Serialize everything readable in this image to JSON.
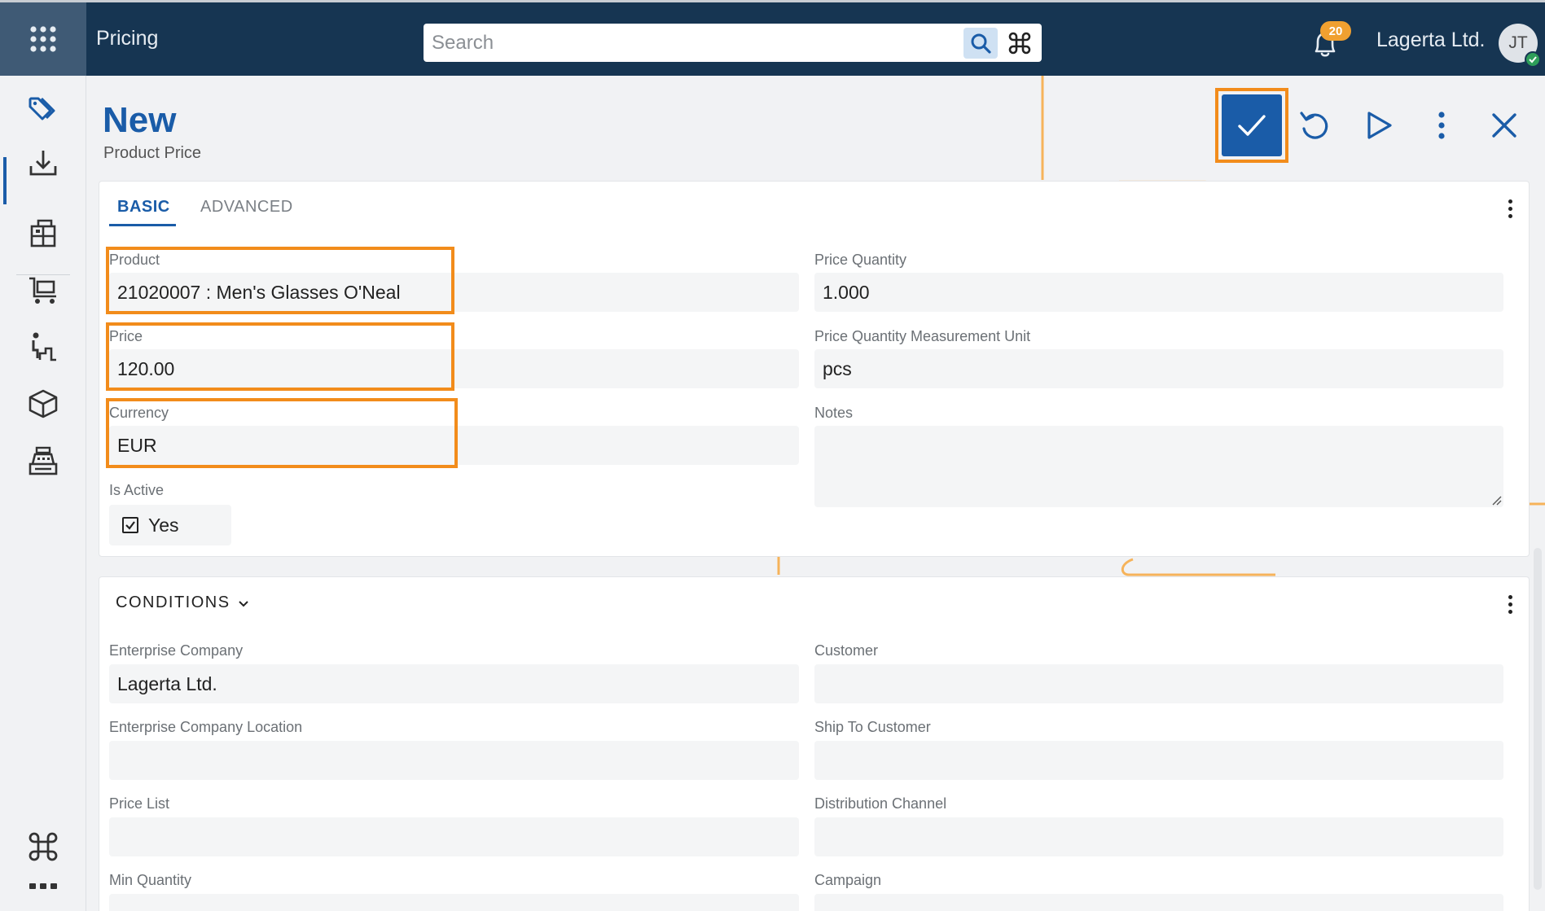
{
  "header": {
    "app_title": "Pricing",
    "search_placeholder": "Search",
    "notification_count": "20",
    "company": "Lagerta Ltd.",
    "user_initials": "JT"
  },
  "sidebar": {
    "items": [
      {
        "icon": "price-tag-icon",
        "active": true
      },
      {
        "icon": "download-tray-icon"
      },
      {
        "icon": "warehouse-boxes-icon"
      },
      {
        "icon": "shopping-cart-icon"
      },
      {
        "icon": "stairs-person-icon"
      },
      {
        "icon": "package-cube-icon"
      },
      {
        "icon": "cash-register-icon"
      },
      {
        "icon": "command-grid-icon"
      },
      {
        "icon": "more-dots-icon"
      }
    ]
  },
  "page": {
    "title": "New",
    "subtitle": "Product Price"
  },
  "toolbar": {
    "actions": [
      "save-check-icon",
      "undo-icon",
      "run-play-icon",
      "more-vertical-icon",
      "close-icon"
    ]
  },
  "basic_card": {
    "tabs": [
      {
        "label": "BASIC",
        "active": true
      },
      {
        "label": "ADVANCED",
        "active": false
      }
    ],
    "fields": {
      "product": {
        "label": "Product",
        "value": "21020007 : Men's Glasses O'Neal"
      },
      "price": {
        "label": "Price",
        "value": "120.00"
      },
      "currency": {
        "label": "Currency",
        "value": "EUR"
      },
      "is_active": {
        "label": "Is Active",
        "value": "Yes"
      },
      "price_quantity": {
        "label": "Price Quantity",
        "value": "1.000"
      },
      "price_quantity_unit": {
        "label": "Price Quantity Measurement Unit",
        "value": "pcs"
      },
      "notes": {
        "label": "Notes",
        "value": ""
      }
    }
  },
  "conditions_card": {
    "title": "CONDITIONS",
    "fields": {
      "enterprise_company": {
        "label": "Enterprise Company",
        "value": "Lagerta Ltd."
      },
      "customer": {
        "label": "Customer",
        "value": ""
      },
      "enterprise_company_location": {
        "label": "Enterprise Company Location",
        "value": ""
      },
      "ship_to_customer": {
        "label": "Ship To Customer",
        "value": ""
      },
      "price_list": {
        "label": "Price List",
        "value": ""
      },
      "distribution_channel": {
        "label": "Distribution Channel",
        "value": ""
      },
      "min_quantity": {
        "label": "Min Quantity",
        "value": ""
      },
      "campaign": {
        "label": "Campaign",
        "value": ""
      }
    }
  },
  "colors": {
    "topbar": "#163552",
    "accent": "#1a5ca8",
    "highlight": "#f28c1b",
    "badge": "#f0a030"
  }
}
